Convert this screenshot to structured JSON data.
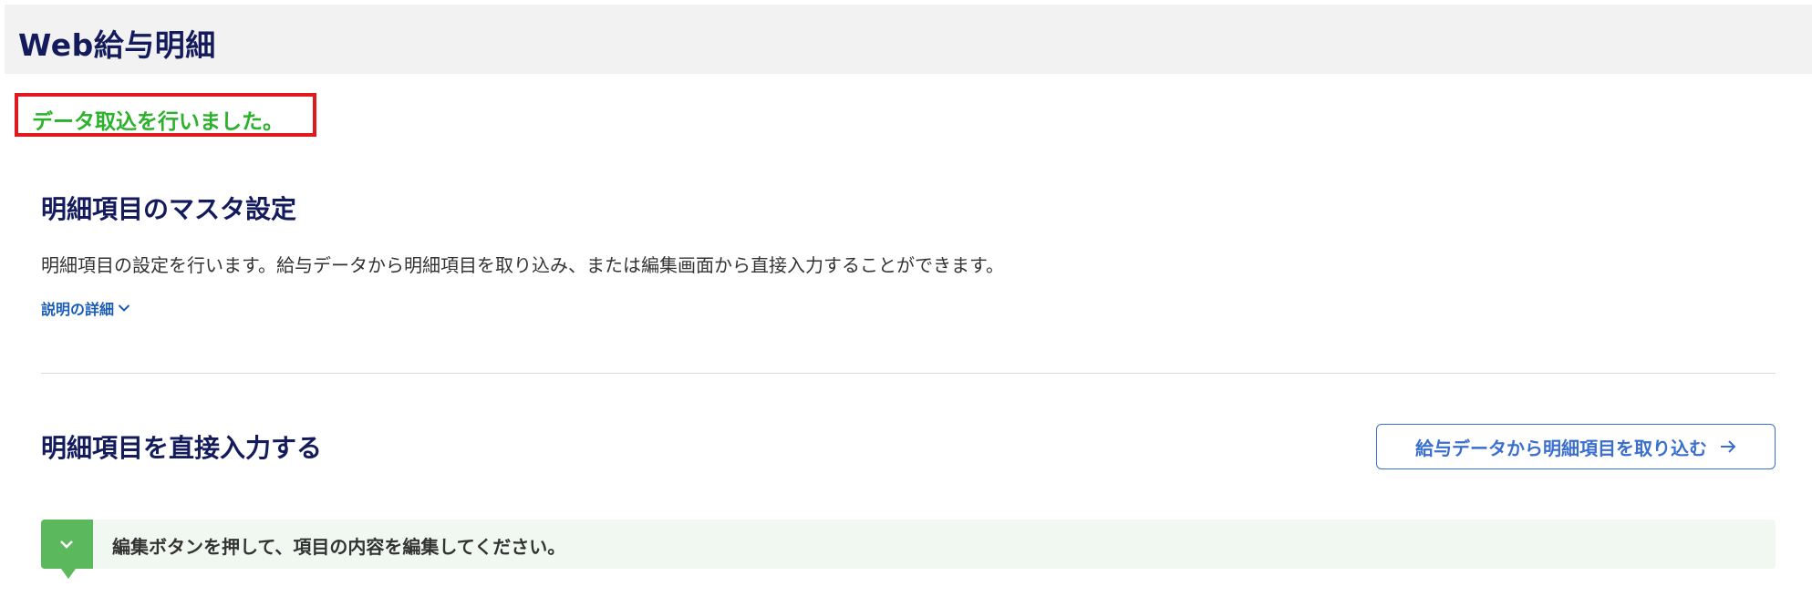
{
  "header": {
    "title": "Web給与明細"
  },
  "alert": {
    "message": "データ取込を行いました。"
  },
  "master_section": {
    "title": "明細項目のマスタ設定",
    "description": "明細項目の設定を行います。給与データから明細項目を取り込み、または編集画面から直接入力することができます。",
    "details_link": "説明の詳細"
  },
  "direct_input_section": {
    "title": "明細項目を直接入力する",
    "import_button": "給与データから明細項目を取り込む"
  },
  "info_bar": {
    "message": "編集ボタンを押して、項目の内容を編集してください。"
  },
  "colors": {
    "title_navy": "#141b5c",
    "alert_border": "#e0191e",
    "alert_text": "#2bb12b",
    "link_blue": "#1a5db5",
    "button_blue": "#3a6fcf",
    "info_green": "#5cb85c",
    "info_bg": "#f1f8f1"
  },
  "icons": {
    "details_toggle": "chevron-down-icon",
    "import_arrow": "arrow-right-icon",
    "info_expand": "chevron-down-icon"
  }
}
